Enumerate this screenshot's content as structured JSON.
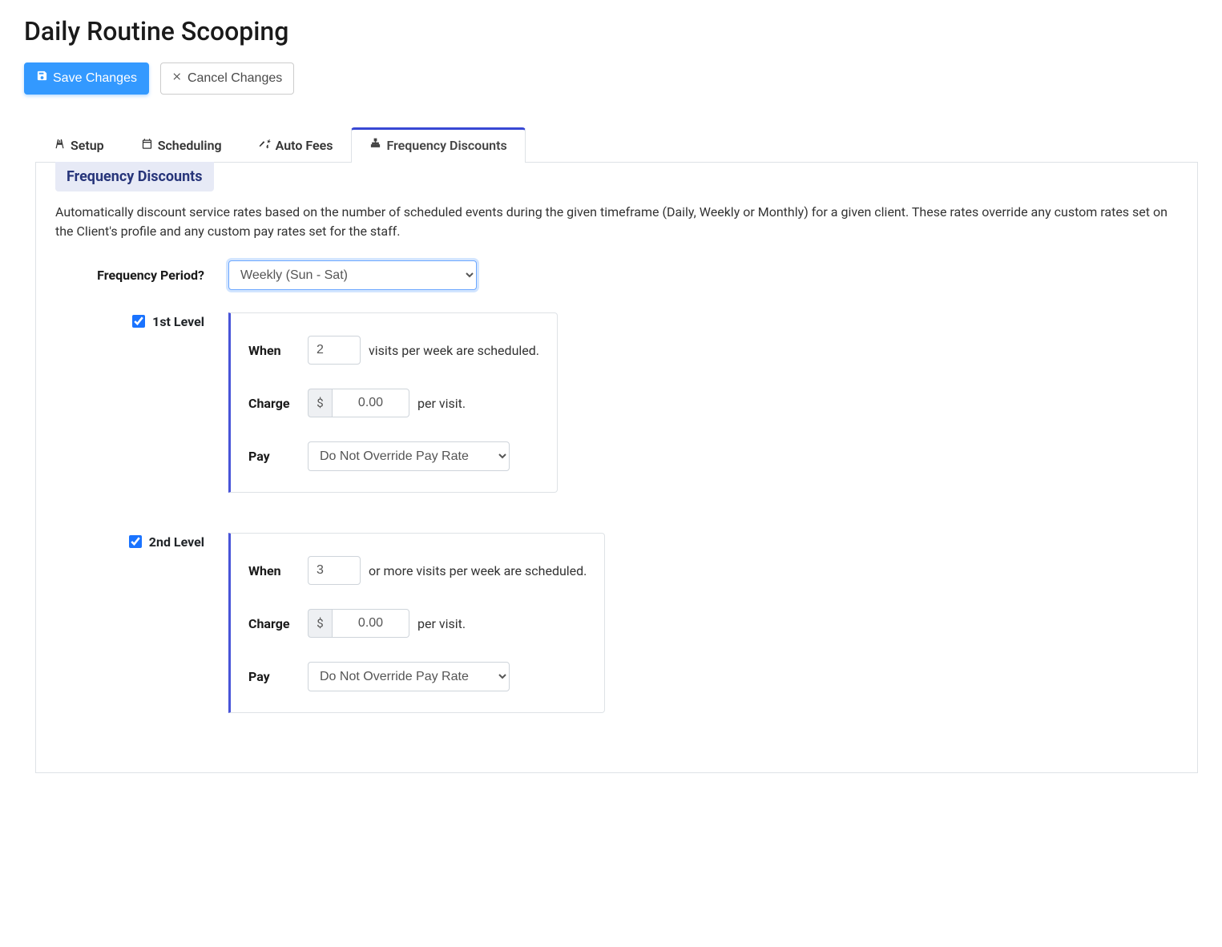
{
  "page_title": "Daily Routine Scooping",
  "buttons": {
    "save": "Save Changes",
    "cancel": "Cancel Changes"
  },
  "tabs": {
    "setup": "Setup",
    "scheduling": "Scheduling",
    "autofees": "Auto Fees",
    "freq": "Frequency Discounts"
  },
  "panel": {
    "legend": "Frequency Discounts",
    "description": "Automatically discount service rates based on the number of scheduled events during the given timeframe (Daily, Weekly or Monthly) for a given client. These rates override any custom rates set on the Client's profile and any custom pay rates set for the staff.",
    "period_label": "Frequency Period?",
    "period_value": "Weekly (Sun - Sat)"
  },
  "labels": {
    "when": "When",
    "charge": "Charge",
    "pay": "Pay",
    "per_visit": "per visit.",
    "currency": "$"
  },
  "levels": [
    {
      "title": "1st Level",
      "checked": true,
      "visits": "2",
      "suffix": "visits per week are scheduled.",
      "charge": "0.00",
      "pay_value": "Do Not Override Pay Rate"
    },
    {
      "title": "2nd Level",
      "checked": true,
      "visits": "3",
      "suffix": "or more visits per week are scheduled.",
      "charge": "0.00",
      "pay_value": "Do Not Override Pay Rate"
    }
  ]
}
